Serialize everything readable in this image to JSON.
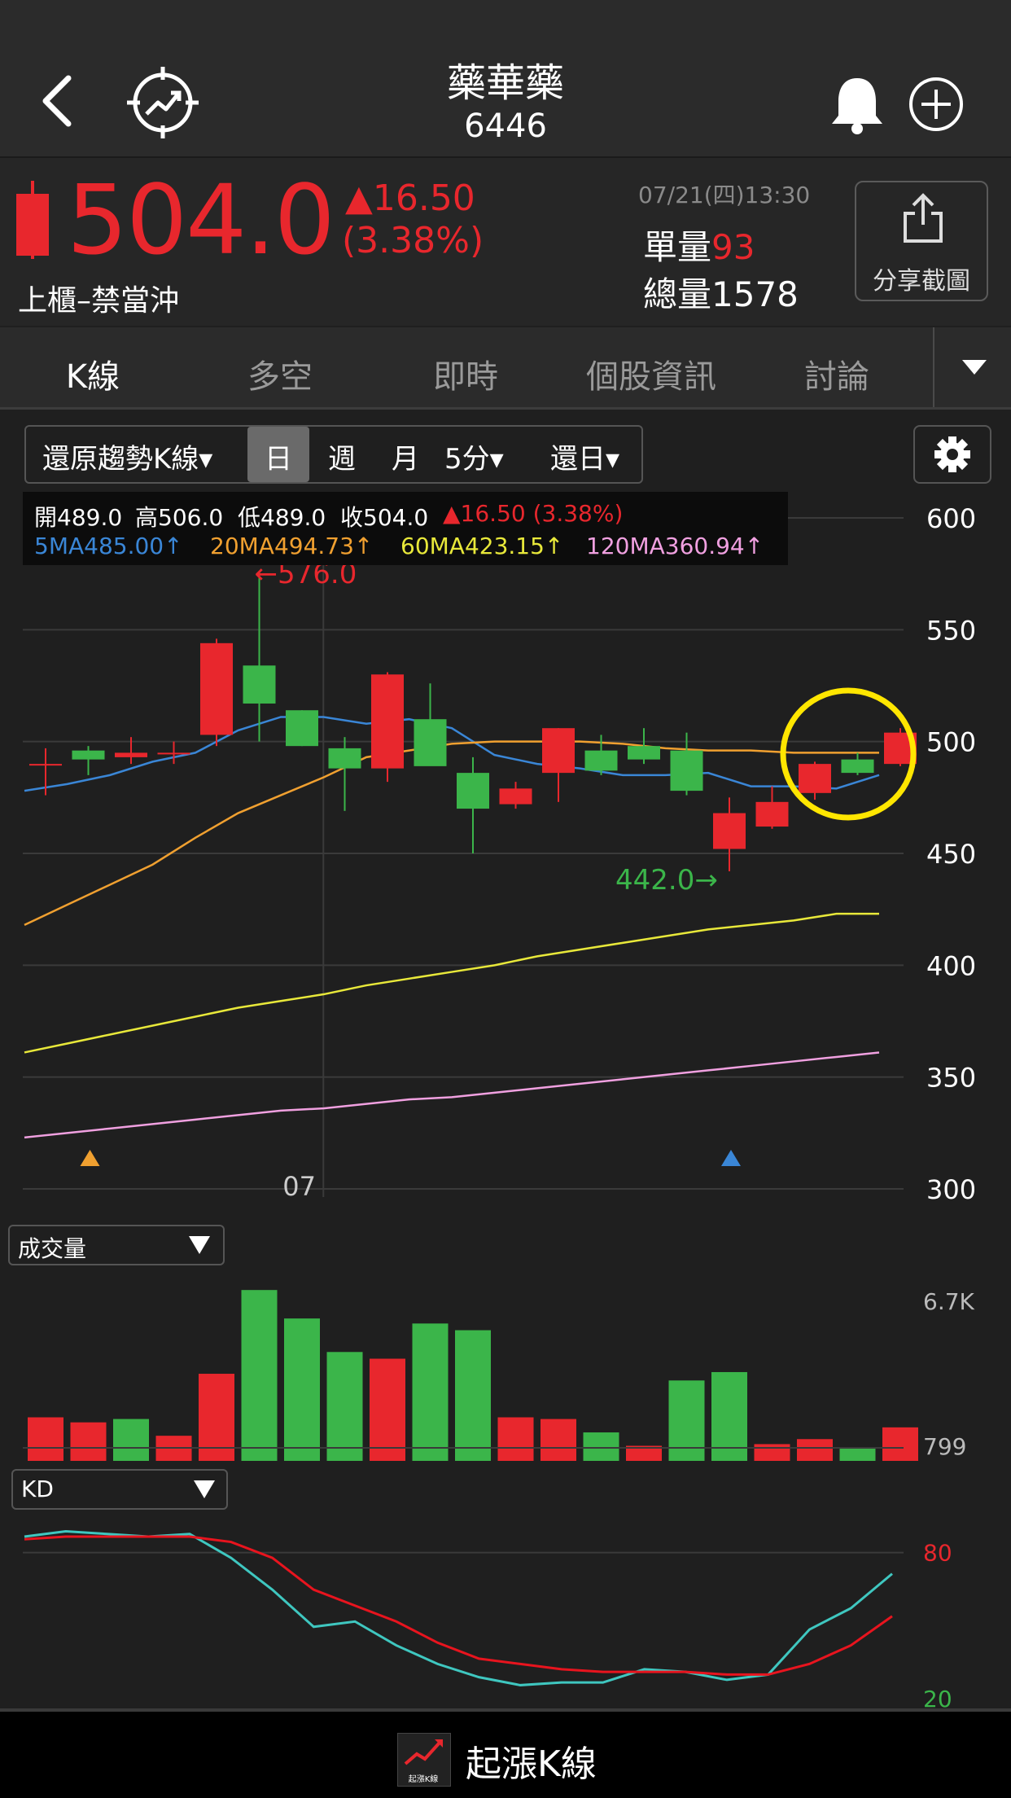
{
  "header": {
    "name": "藥華藥",
    "code": "6446"
  },
  "quote": {
    "price": "504.0",
    "change": "▲16.50",
    "change_pct": "(3.38%)",
    "market_status": "上櫃–禁當沖",
    "datetime": "07/21(四)13:30",
    "single_vol_label": "單量",
    "single_vol": "93",
    "total_vol_label": "總量",
    "total_vol": "1578",
    "share_label": "分享截圖"
  },
  "tabs": [
    "K線",
    "多空",
    "即時",
    "個股資訊",
    "討論"
  ],
  "toolbar": {
    "kline_type": "還原趨勢K線▾",
    "periods": [
      "日",
      "週",
      "月",
      "5分▾",
      "還日▾"
    ],
    "active": "日"
  },
  "info": {
    "open": "開489.0",
    "high": "高506.0",
    "low": "低489.0",
    "close": "收504.0",
    "change": "▲16.50 (3.38%)",
    "ma5": "5MA485.00↑",
    "ma20": "20MA494.73↑",
    "ma60": "60MA423.15↑",
    "ma120": "120MA360.94↑"
  },
  "colors": {
    "up": "#e8272d",
    "down": "#3bb54a",
    "ma5": "#3a86d6",
    "ma20": "#f0a030",
    "ma60": "#e8e83a",
    "ma120": "#f0a0e0",
    "k_line": "#3fc7c0",
    "d_line": "#e8141e",
    "highlight_circle": "#ffe600"
  },
  "panels": {
    "volume_label": "成交量",
    "kd_label": "KD",
    "dropdown_icon": "caret-down-icon"
  },
  "footer": {
    "brand": "起漲K線",
    "logo_text": "起漲K線"
  },
  "chart_data": [
    {
      "type": "candlestick",
      "title": "",
      "x_label": "07",
      "y_ticks": [
        600,
        550,
        500,
        450,
        400,
        350,
        300
      ],
      "ylim": [
        300,
        600
      ],
      "annotations": [
        "←576.0",
        "442.0→"
      ],
      "candles": [
        {
          "o": 490,
          "h": 497,
          "l": 476,
          "c": 490
        },
        {
          "o": 496,
          "h": 498,
          "l": 485,
          "c": 492
        },
        {
          "o": 493,
          "h": 502,
          "l": 490,
          "c": 495
        },
        {
          "o": 495,
          "h": 500,
          "l": 490,
          "c": 495
        },
        {
          "o": 503,
          "h": 546,
          "l": 498,
          "c": 544
        },
        {
          "o": 534,
          "h": 576,
          "l": 500,
          "c": 517
        },
        {
          "o": 514,
          "h": 514,
          "l": 498,
          "c": 498
        },
        {
          "o": 497,
          "h": 502,
          "l": 469,
          "c": 488
        },
        {
          "o": 488,
          "h": 531,
          "l": 482,
          "c": 530
        },
        {
          "o": 510,
          "h": 526,
          "l": 490,
          "c": 489
        },
        {
          "o": 486,
          "h": 493,
          "l": 450,
          "c": 470
        },
        {
          "o": 472,
          "h": 482,
          "l": 470,
          "c": 479
        },
        {
          "o": 486,
          "h": 506,
          "l": 473,
          "c": 506
        },
        {
          "o": 496,
          "h": 503,
          "l": 485,
          "c": 487
        },
        {
          "o": 498,
          "h": 506,
          "l": 490,
          "c": 492
        },
        {
          "o": 496,
          "h": 504,
          "l": 476,
          "c": 478
        },
        {
          "o": 452,
          "h": 475,
          "l": 442,
          "c": 468
        },
        {
          "o": 462,
          "h": 480,
          "l": 461,
          "c": 473
        },
        {
          "o": 477,
          "h": 491,
          "l": 474,
          "c": 490
        },
        {
          "o": 492,
          "h": 495,
          "l": 485,
          "c": 486
        },
        {
          "o": 490,
          "h": 506,
          "l": 489,
          "c": 504
        }
      ],
      "series": [
        {
          "name": "5MA",
          "values": [
            478,
            481,
            485,
            491,
            495,
            505,
            511,
            511,
            508,
            510,
            506,
            494,
            490,
            488,
            485,
            485,
            486,
            480,
            480,
            479,
            485
          ]
        },
        {
          "name": "20MA",
          "values": [
            418,
            427,
            436,
            445,
            457,
            468,
            476,
            484,
            493,
            496,
            499,
            500,
            500,
            500,
            499,
            497,
            496,
            496,
            495,
            495,
            495
          ]
        },
        {
          "name": "60MA",
          "values": [
            361,
            365,
            369,
            373,
            377,
            381,
            384,
            387,
            391,
            394,
            397,
            400,
            404,
            407,
            410,
            413,
            416,
            418,
            420,
            423,
            423
          ]
        },
        {
          "name": "120MA",
          "values": [
            323,
            325,
            327,
            329,
            331,
            333,
            335,
            336,
            338,
            340,
            341,
            343,
            345,
            347,
            349,
            351,
            353,
            355,
            357,
            359,
            361
          ]
        }
      ],
      "markers": [
        {
          "index": 1,
          "color": "#f0a030"
        },
        {
          "index": 16,
          "color": "#3a86d6"
        }
      ]
    },
    {
      "type": "bar",
      "title": "成交量",
      "y_ticks": [
        "6.7K",
        "799"
      ],
      "values": [
        2.6,
        2.3,
        2.5,
        1.5,
        5.2,
        10.2,
        8.5,
        6.5,
        6.1,
        8.2,
        7.8,
        2.6,
        2.5,
        1.7,
        0.9,
        4.8,
        5.3,
        1.0,
        1.3,
        0.8,
        2.0
      ],
      "colors": [
        "up",
        "up",
        "down",
        "up",
        "up",
        "down",
        "down",
        "down",
        "up",
        "down",
        "down",
        "up",
        "up",
        "down",
        "up",
        "down",
        "down",
        "up",
        "up",
        "down",
        "up"
      ]
    },
    {
      "type": "line",
      "title": "KD",
      "y_ticks": [
        80,
        20
      ],
      "ylim": [
        20,
        90
      ],
      "series": [
        {
          "name": "K",
          "values": [
            86,
            88,
            87,
            86,
            87,
            78,
            66,
            52,
            54,
            45,
            38,
            33,
            30,
            31,
            31,
            36,
            35,
            32,
            34,
            51,
            59,
            72
          ]
        },
        {
          "name": "D",
          "values": [
            85,
            86,
            86,
            86,
            86,
            84,
            78,
            66,
            60,
            54,
            46,
            40,
            38,
            36,
            35,
            35,
            35,
            34,
            34,
            38,
            45,
            56
          ]
        }
      ]
    }
  ]
}
